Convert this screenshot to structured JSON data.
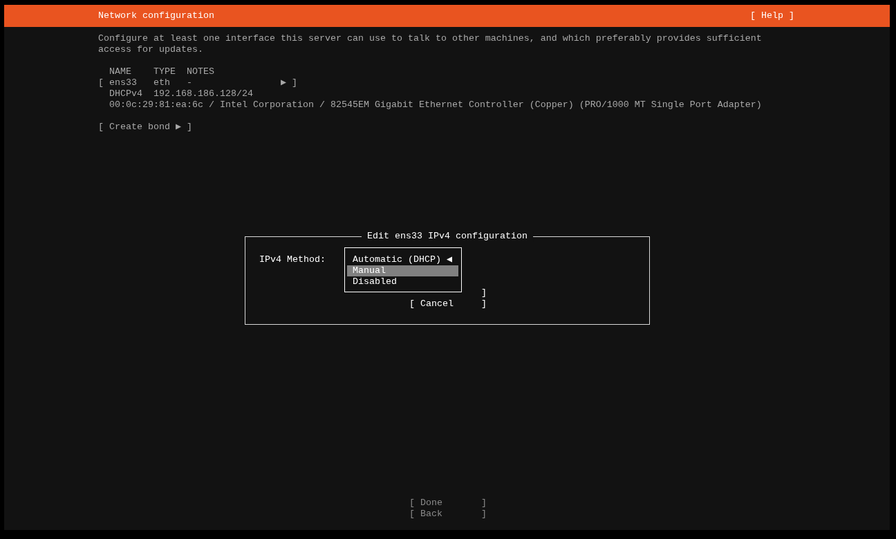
{
  "header": {
    "title": "Network configuration",
    "help": "[ Help ]"
  },
  "intro": "Configure at least one interface this server can use to talk to other machines, and which preferably provides sufficient access for updates.",
  "interfaces": {
    "columns": [
      "NAME",
      "TYPE",
      "NOTES"
    ],
    "rows": [
      {
        "open": "[",
        "name": "ens33",
        "type": "eth",
        "notes": "-",
        "arrow": "▶",
        "close": "]",
        "details": [
          {
            "label": "DHCPv4",
            "value": "192.168.186.128/24"
          }
        ],
        "hardware": "00:0c:29:81:ea:6c / Intel Corporation / 82545EM Gigabit Ethernet Controller (Copper) (PRO/1000 MT Single Port Adapter)"
      }
    ]
  },
  "create_bond": "[ Create bond ▶ ]",
  "dialog": {
    "title": "Edit ens33 IPv4 configuration",
    "field_label": "IPv4 Method:",
    "current_marker": "◀",
    "options": [
      {
        "label": "Automatic (DHCP)",
        "current": true,
        "selected": false
      },
      {
        "label": "Manual",
        "current": false,
        "selected": true
      },
      {
        "label": "Disabled",
        "current": false,
        "selected": false
      }
    ],
    "hidden_button_fragment": "]",
    "cancel": "[ Cancel     ]"
  },
  "buttons": [
    {
      "label": "[ Done       ]",
      "disabled": true
    },
    {
      "label": "[ Back       ]",
      "disabled": true
    }
  ]
}
